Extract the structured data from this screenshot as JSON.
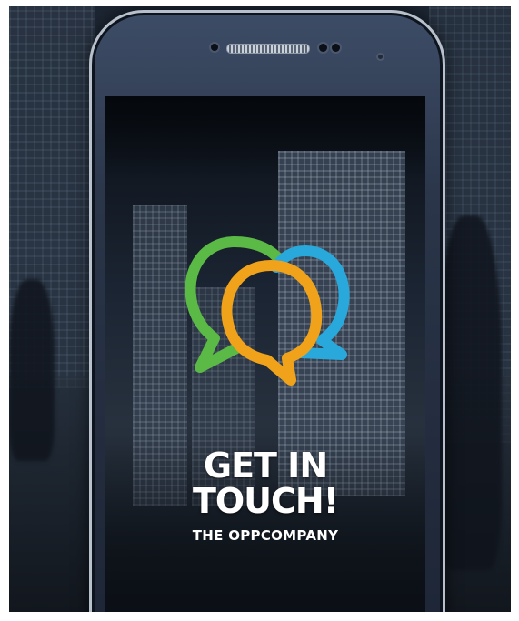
{
  "splash": {
    "title_line1": "GET IN",
    "title_line2": "TOUCH!",
    "subtitle": "THE OPPCOMPANY"
  },
  "logo": {
    "icon": "three-speech-bubbles-logo",
    "colors": {
      "green": "#5bb946",
      "orange": "#f0a31a",
      "blue": "#29a8dc"
    }
  }
}
